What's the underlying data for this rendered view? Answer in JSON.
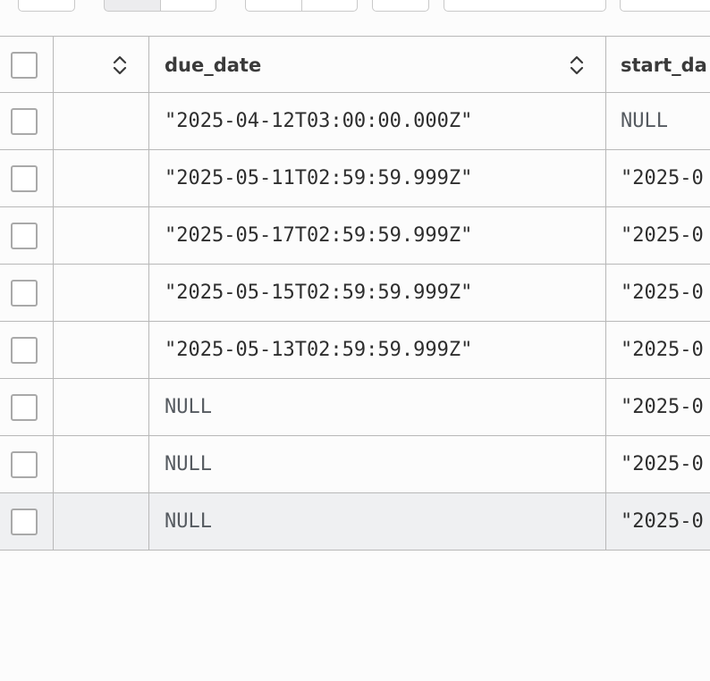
{
  "columns": {
    "due_date": "due_date",
    "start_date": "start_da"
  },
  "rows": [
    {
      "due_date": "\"2025-04-12T03:00:00.000Z\"",
      "start_date": "NULL",
      "due_null": false,
      "start_null": true
    },
    {
      "due_date": "\"2025-05-11T02:59:59.999Z\"",
      "start_date": "\"2025-0",
      "due_null": false,
      "start_null": false
    },
    {
      "due_date": "\"2025-05-17T02:59:59.999Z\"",
      "start_date": "\"2025-0",
      "due_null": false,
      "start_null": false
    },
    {
      "due_date": "\"2025-05-15T02:59:59.999Z\"",
      "start_date": "\"2025-0",
      "due_null": false,
      "start_null": false
    },
    {
      "due_date": "\"2025-05-13T02:59:59.999Z\"",
      "start_date": "\"2025-0",
      "due_null": false,
      "start_null": false
    },
    {
      "due_date": "NULL",
      "start_date": "\"2025-0",
      "due_null": true,
      "start_null": false
    },
    {
      "due_date": "NULL",
      "start_date": "\"2025-0",
      "due_null": true,
      "start_null": false
    },
    {
      "due_date": "NULL",
      "start_date": "\"2025-0",
      "due_null": true,
      "start_null": false,
      "selected": true
    }
  ],
  "icons": {
    "sort": "sort-icon",
    "checkbox": "checkbox"
  }
}
